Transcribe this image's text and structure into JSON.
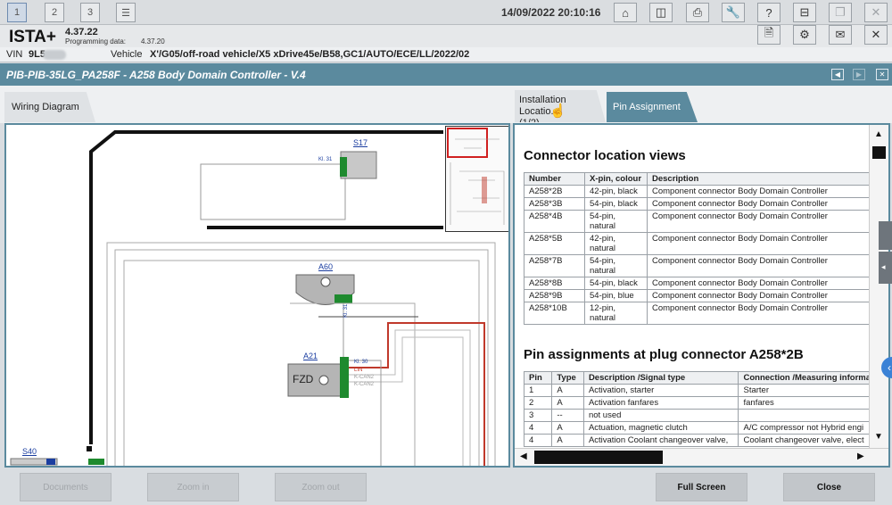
{
  "topbar": {
    "tabs": [
      "1",
      "2",
      "3"
    ],
    "datetime": "14/09/2022 20:10:16",
    "icons": [
      "list-icon",
      "home-icon",
      "compare-icon",
      "print-icon",
      "wrench-icon",
      "help-icon",
      "download-icon",
      "window-icon",
      "close-icon"
    ]
  },
  "app": {
    "name": "ISTA+",
    "version": "4.37.22",
    "prog_label": "Programming data:",
    "prog_value": "4.37.20",
    "header_icons": [
      "document-icon",
      "gear-icon",
      "mail-icon",
      "close-icon"
    ]
  },
  "vehicle": {
    "vin_label": "VIN",
    "vin_value": "9L5",
    "vehicle_label": "Vehicle",
    "vehicle_value": "X'/G05/off-road vehicle/X5 xDrive45e/B58,GC1/AUTO/ECE/LL/2022/02"
  },
  "title": "PIB-PIB-35LG_PA258F - A258 Body Domain Controller - V.4",
  "tabs": {
    "wiring": "Wiring Diagram",
    "installation_line1": "Installation Locatio...",
    "installation_line2": "(1/2)",
    "pin": "Pin Assignment"
  },
  "diagram": {
    "labels": {
      "s17": "S17",
      "kl31_a": "Kl. 31",
      "a60": "A60",
      "kl31_b": "Kl. 31",
      "a21": "A21",
      "fzd": "FZD",
      "kl30": "Kl. 30",
      "lin": "LIN",
      "kcan2": "K-CAN2",
      "kcan2b": "K-CAN2",
      "s40": "S40"
    }
  },
  "connector_views": {
    "heading": "Connector location views",
    "headers": [
      "Number",
      "X-pin, colour",
      "Description"
    ],
    "rows": [
      [
        "A258*2B",
        "42-pin, black",
        "Component connector Body Domain Controller"
      ],
      [
        "A258*3B",
        "54-pin, black",
        "Component connector Body Domain Controller"
      ],
      [
        "A258*4B",
        "54-pin,\nnatural",
        "Component connector Body Domain Controller"
      ],
      [
        "A258*5B",
        "42-pin,\nnatural",
        "Component connector Body Domain Controller"
      ],
      [
        "A258*7B",
        "54-pin,\nnatural",
        "Component connector Body Domain Controller"
      ],
      [
        "A258*8B",
        "54-pin, black",
        "Component connector Body Domain Controller"
      ],
      [
        "A258*9B",
        "54-pin, blue",
        "Component connector Body Domain Controller"
      ],
      [
        "A258*10B",
        "12-pin,\nnatural",
        "Component connector Body Domain Controller"
      ]
    ]
  },
  "pin_assignments": {
    "heading": "Pin assignments at plug connector A258*2B",
    "headers": [
      "Pin",
      "Type",
      "Description /Signal type",
      "Connection /Measuring informa"
    ],
    "rows": [
      [
        "1",
        "A",
        "Activation, starter",
        "Starter"
      ],
      [
        "2",
        "A",
        "Activation fanfares",
        "fanfares"
      ],
      [
        "3",
        "--",
        "not used",
        ""
      ],
      [
        "4",
        "A",
        "Actuation, magnetic clutch",
        "A/C compressor not Hybrid engi"
      ],
      [
        "4",
        "A",
        "Activation Coolant changeover valve,",
        "Coolant changeover valve, elect"
      ]
    ]
  },
  "bottom": {
    "documents": "Documents",
    "zoom_in": "Zoom in",
    "zoom_out": "Zoom out",
    "full_screen": "Full Screen",
    "close": "Close"
  },
  "colors": {
    "accent": "#5b8a9e",
    "wire_red": "#c0392b",
    "connector_green": "#1e8a2e"
  }
}
